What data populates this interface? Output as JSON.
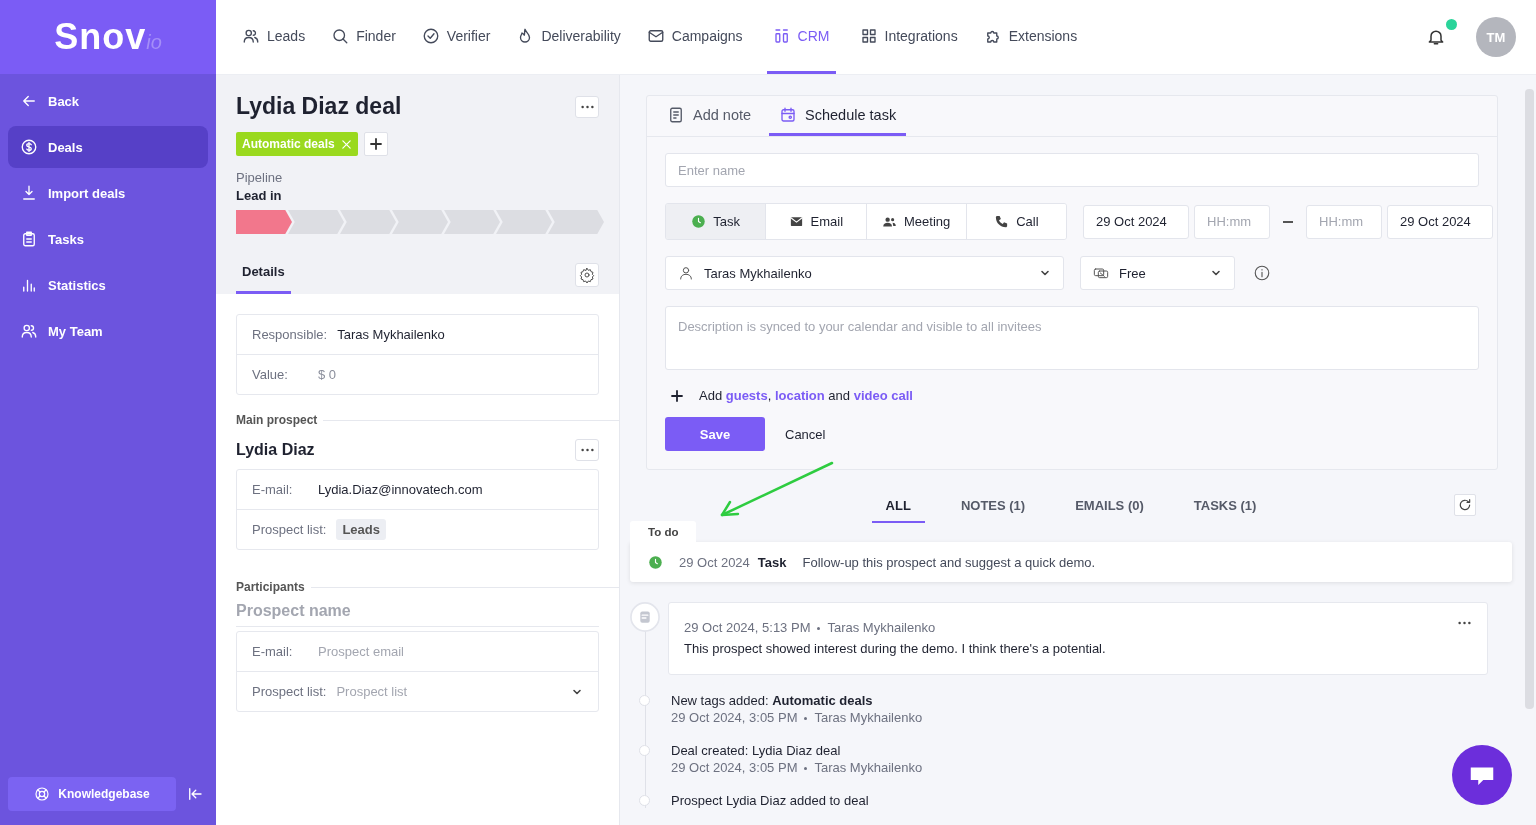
{
  "logo": {
    "name": "Snov",
    "suffix": "io"
  },
  "sidebar": {
    "items": [
      {
        "label": "Back",
        "selected": false
      },
      {
        "label": "Deals",
        "selected": true
      },
      {
        "label": "Import deals",
        "selected": false
      },
      {
        "label": "Tasks",
        "selected": false
      },
      {
        "label": "Statistics",
        "selected": false
      },
      {
        "label": "My Team",
        "selected": false
      }
    ],
    "footer": {
      "label": "Knowledgebase"
    }
  },
  "nav": {
    "items": [
      {
        "label": "Leads",
        "selected": false
      },
      {
        "label": "Finder",
        "selected": false
      },
      {
        "label": "Verifier",
        "selected": false
      },
      {
        "label": "Deliverability",
        "selected": false
      },
      {
        "label": "Campaigns",
        "selected": false
      },
      {
        "label": "CRM",
        "selected": true
      },
      {
        "label": "Integrations",
        "selected": false
      },
      {
        "label": "Extensions",
        "selected": false
      }
    ],
    "notifications": {
      "unread": true
    },
    "avatar": "TM"
  },
  "deal": {
    "title": "Lydia Diaz deal",
    "tags": [
      "Automatic deals"
    ],
    "pipeline_label": "Pipeline",
    "stage": "Lead in",
    "stages": [
      {
        "active": true
      },
      {
        "active": false
      },
      {
        "active": false
      },
      {
        "active": false
      },
      {
        "active": false
      },
      {
        "active": false
      },
      {
        "active": false
      }
    ],
    "tabs": [
      {
        "label": "Details",
        "selected": true
      }
    ],
    "details": [
      {
        "label": "Responsible:",
        "value": "Taras Mykhailenko",
        "kind": "text"
      },
      {
        "label": "Value:",
        "value": "$ 0",
        "kind": "muted"
      }
    ]
  },
  "main_prospect": {
    "heading": "Main prospect",
    "name": "Lydia Diaz",
    "fields": [
      {
        "label": "E-mail:",
        "value": "Lydia.Diaz@innovatech.com",
        "kind": "text"
      },
      {
        "label": "Prospect list:",
        "value": "Leads",
        "kind": "chip"
      }
    ]
  },
  "participants": {
    "heading": "Participants",
    "name_placeholder": "Prospect name",
    "fields": [
      {
        "label": "E-mail:",
        "placeholder": "Prospect email",
        "kind": "input"
      },
      {
        "label": "Prospect list:",
        "placeholder": "Prospect list",
        "kind": "select"
      }
    ]
  },
  "composer": {
    "tabs": [
      {
        "label": "Add note",
        "selected": false
      },
      {
        "label": "Schedule task",
        "selected": true
      }
    ],
    "name_placeholder": "Enter name",
    "types": [
      {
        "label": "Task",
        "selected": true
      },
      {
        "label": "Email",
        "selected": false
      },
      {
        "label": "Meeting",
        "selected": false
      },
      {
        "label": "Call",
        "selected": false
      }
    ],
    "start_date": "29 Oct 2024",
    "start_time_placeholder": "HH:mm",
    "end_time_placeholder": "HH:mm",
    "end_date": "29 Oct 2024",
    "assignee": "Taras Mykhailenko",
    "availability": "Free",
    "description_placeholder": "Description is synced to your calendar and visible to all invitees",
    "add_more": "Add **guests**, **location** and **video call**",
    "save": "Save",
    "cancel": "Cancel"
  },
  "activity": {
    "filters": [
      {
        "label": "ALL",
        "selected": true
      },
      {
        "label": "NOTES (1)",
        "selected": false
      },
      {
        "label": "EMAILS (0)",
        "selected": false
      },
      {
        "label": "TASKS (1)",
        "selected": false
      }
    ],
    "todo_label": "To do",
    "todo": [
      {
        "date": "29 Oct 2024",
        "type": "Task",
        "text": "Follow-up this prospect and suggest a quick demo."
      }
    ],
    "timeline": [
      {
        "kind": "note",
        "date": "29 Oct 2024, 5:13 PM",
        "author": "Taras Mykhailenko",
        "text": "This prospect showed interest during the demo. I think there's a potential."
      },
      {
        "kind": "event",
        "text": "New tags added: **Automatic deals**",
        "date": "29 Oct 2024, 3:05 PM",
        "author": "Taras Mykhailenko"
      },
      {
        "kind": "event",
        "text": "Deal created: Lydia Diaz deal",
        "date": "29 Oct 2024, 3:05 PM",
        "author": "Taras Mykhailenko"
      },
      {
        "kind": "event",
        "text": "Prospect Lydia Diaz added to deal"
      }
    ]
  }
}
